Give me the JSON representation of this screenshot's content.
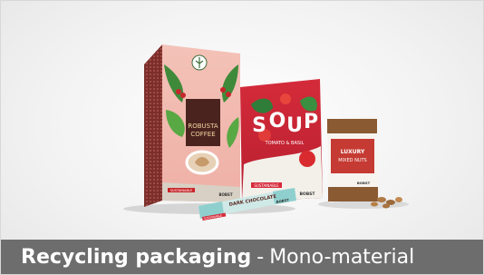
{
  "caption": {
    "title": "Recycling packaging",
    "separator": "-",
    "subtitle": "Mono-material"
  },
  "products": {
    "coffee": {
      "line1": "ROBUSTA",
      "line2": "COFFEE",
      "badge": "SUSTAINABLE",
      "brand": "BOBST"
    },
    "soup": {
      "letters": [
        "S",
        "O",
        "U",
        "P"
      ],
      "sub": "TOMATO & BASIL",
      "badge": "SUSTAINABLE",
      "brand": "BOBST"
    },
    "nuts": {
      "line1": "LUXURY",
      "line2": "MIXED NUTS",
      "brand": "BOBST"
    },
    "chocolate": {
      "label": "DARK CHOCOLATE",
      "badge": "SUSTAINABLE",
      "brand": "BOBST"
    }
  },
  "colors": {
    "coffee_pink": "#f2b4ab",
    "coffee_dark": "#6a2d2a",
    "soup_red": "#d62a3a",
    "nuts_red": "#c53a32",
    "choc_teal": "#8fd0cf",
    "caption_bg": "#6d6d6d"
  }
}
